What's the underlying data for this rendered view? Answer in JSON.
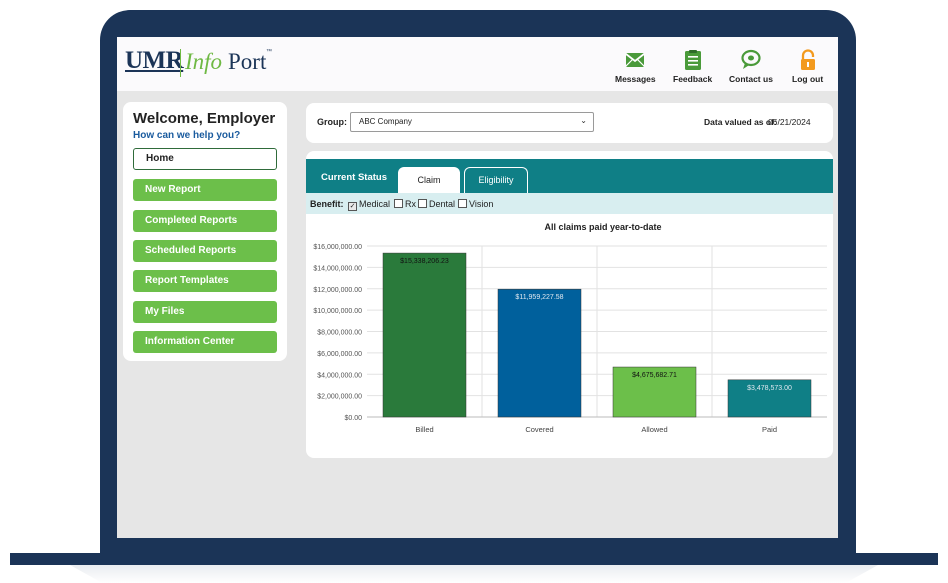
{
  "header": {
    "logo_umr": "UMR",
    "logo_info": "Info",
    "logo_port": "Port",
    "logo_tm": "™",
    "nav": [
      {
        "label": "Messages",
        "icon": "envelope-icon"
      },
      {
        "label": "Feedback",
        "icon": "clipboard-icon"
      },
      {
        "label": "Contact us",
        "icon": "chat-bubble-icon"
      },
      {
        "label": "Log out",
        "icon": "padlock-icon"
      }
    ]
  },
  "sidebar": {
    "welcome": "Welcome, Employer",
    "help": "How can we help you?",
    "items": [
      {
        "label": "Home"
      },
      {
        "label": "New Report"
      },
      {
        "label": "Completed Reports"
      },
      {
        "label": "Scheduled Reports"
      },
      {
        "label": "Report Templates"
      },
      {
        "label": "My Files"
      },
      {
        "label": "Information Center"
      }
    ]
  },
  "group": {
    "label": "Group:",
    "selected": "ABC Company",
    "data_valued_label": "Data valued as of:",
    "data_valued_date": "06/21/2024"
  },
  "status": {
    "current_status_label": "Current Status",
    "tabs": [
      {
        "label": "Claim"
      },
      {
        "label": "Eligibility"
      }
    ],
    "benefit_label": "Benefit:",
    "benefits": [
      {
        "label": "Medical",
        "checked": true
      },
      {
        "label": "Rx",
        "checked": false
      },
      {
        "label": "Dental",
        "checked": false
      },
      {
        "label": "Vision",
        "checked": false
      }
    ]
  },
  "colors": {
    "frame": "#1b3457",
    "teal": "#0f7f86",
    "nav_green": "#6cbf4a",
    "bar_billed": "#2a7a3b",
    "bar_covered": "#00609c",
    "bar_allowed": "#6cbf4a",
    "bar_paid": "#0f7f86"
  },
  "chart_data": {
    "type": "bar",
    "title": "All claims paid year-to-date",
    "categories": [
      "Billed",
      "Covered",
      "Allowed",
      "Paid"
    ],
    "values": [
      15338206.23,
      11959227.58,
      4675682.71,
      3478573.0
    ],
    "value_labels": [
      "$15,338,206.23",
      "$11,959,227.58",
      "$4,675,682.71",
      "$3,478,573.00"
    ],
    "colors": [
      "#2a7a3b",
      "#00609c",
      "#6cbf4a",
      "#0f7f86"
    ],
    "ylim": [
      0,
      16000000
    ],
    "yticks": [
      {
        "value": 0,
        "label": "$0.00"
      },
      {
        "value": 2000000,
        "label": "$2,000,000.00"
      },
      {
        "value": 4000000,
        "label": "$4,000,000.00"
      },
      {
        "value": 6000000,
        "label": "$6,000,000.00"
      },
      {
        "value": 8000000,
        "label": "$8,000,000.00"
      },
      {
        "value": 10000000,
        "label": "$10,000,000.00"
      },
      {
        "value": 12000000,
        "label": "$12,000,000.00"
      },
      {
        "value": 14000000,
        "label": "$14,000,000.00"
      },
      {
        "value": 16000000,
        "label": "$16,000,000.00"
      }
    ],
    "grid": true
  }
}
